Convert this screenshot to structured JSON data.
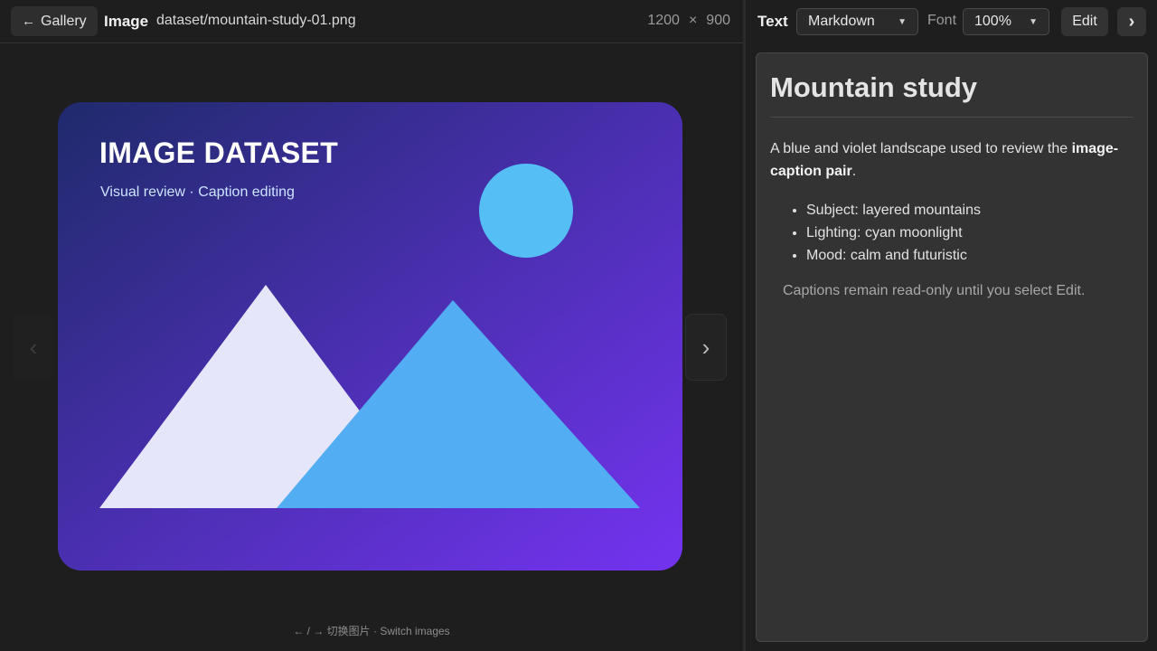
{
  "header": {
    "gallery_label": "Gallery",
    "gallery_arrow": "←",
    "image_label": "Image",
    "path": "dataset/mountain-study-01.png",
    "width": "1200",
    "times": "×",
    "height": "900"
  },
  "viewer": {
    "prev_glyph": "‹",
    "next_glyph": "›",
    "image_title": "IMAGE DATASET",
    "image_subtitle": "Visual review · Caption editing",
    "hint": "← / → 切换图片 · Switch images"
  },
  "panel": {
    "text_label": "Text",
    "format_value": "Markdown",
    "font_label": "Font",
    "font_value": "100%",
    "edit_label": "Edit",
    "next_glyph": "›"
  },
  "caption": {
    "heading": "Mountain study",
    "intro_before": "A blue and violet landscape used to review the ",
    "intro_bold": "image-caption pair",
    "intro_after": ".",
    "bullets": [
      "Subject: layered mountains",
      "Lighting: cyan moonlight",
      "Mood: calm and futuristic"
    ],
    "note": "Captions remain read-only until you select Edit."
  },
  "colors": {
    "gradient_start": "#1f2a6b",
    "gradient_mid": "#4a2fb0",
    "gradient_end": "#7433f0",
    "moon": "#55bff5",
    "mountain_back": "#e6e6fb",
    "mountain_front": "#52adf3"
  }
}
